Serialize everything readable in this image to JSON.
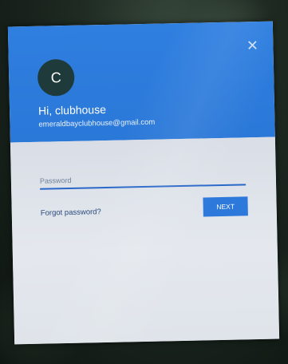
{
  "dialog": {
    "close_icon": "close-icon",
    "avatar_letter": "C",
    "greeting": "Hi, clubhouse",
    "email": "emeraldbayclubhouse@gmail.com",
    "password_placeholder": "Password",
    "password_value": "",
    "forgot_password_label": "Forgot password?",
    "next_label": "NEXT"
  },
  "colors": {
    "header_blue": "#2f7fe0",
    "button_blue": "#2c78db",
    "underline_blue": "#2a68c8",
    "avatar_bg": "#1f3a3a"
  }
}
